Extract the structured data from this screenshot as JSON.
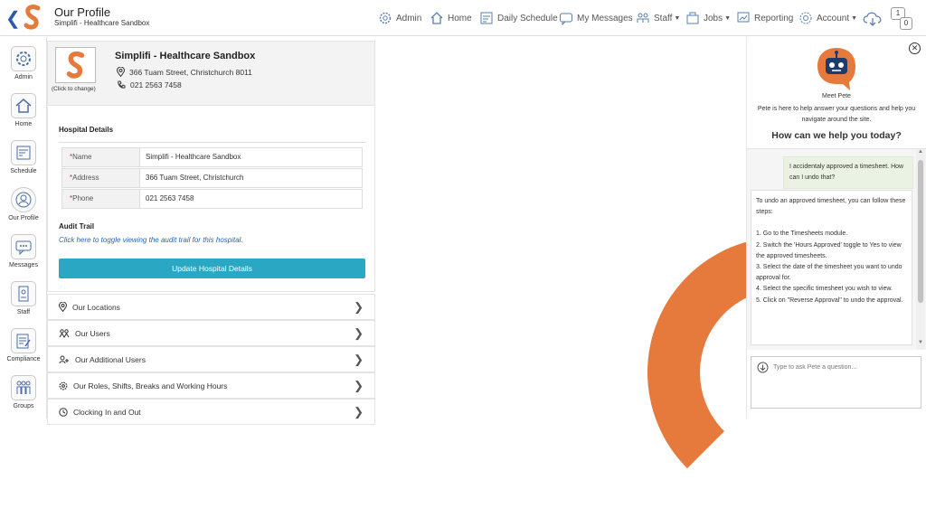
{
  "header": {
    "title": "Our Profile",
    "subtitle": "Simplifi - Healthcare Sandbox",
    "nav": [
      {
        "label": "Admin",
        "icon": "gear-icon"
      },
      {
        "label": "Home",
        "icon": "home-icon"
      },
      {
        "label": "Daily Schedule",
        "icon": "schedule-icon"
      },
      {
        "label": "My Messages",
        "icon": "messages-icon"
      },
      {
        "label": "Staff",
        "icon": "staff-icon"
      },
      {
        "label": "Jobs",
        "icon": "jobs-icon"
      },
      {
        "label": "Reporting",
        "icon": "reporting-icon"
      },
      {
        "label": "Account",
        "icon": "account-icon"
      }
    ],
    "notifications": [
      "1",
      "0"
    ]
  },
  "sidebar": {
    "items": [
      {
        "label": "Admin"
      },
      {
        "label": "Home"
      },
      {
        "label": "Schedule"
      },
      {
        "label": "Our Profile"
      },
      {
        "label": "Messages"
      },
      {
        "label": "Staff"
      },
      {
        "label": "Compliance"
      },
      {
        "label": "Groups"
      }
    ]
  },
  "profile": {
    "logo_caption": "(Click to change)",
    "name": "Simplifi - Healthcare Sandbox",
    "address": "366 Tuam Street, Christchurch 8011",
    "phone": "021 2563 7458"
  },
  "hospital_details": {
    "title": "Hospital Details",
    "fields": [
      {
        "label": "Name",
        "value": "Simplifi - Healthcare Sandbox"
      },
      {
        "label": "Address",
        "value": "366 Tuam Street, Christchurch"
      },
      {
        "label": "Phone",
        "value": "021 2563 7458"
      }
    ],
    "audit_title": "Audit Trail",
    "audit_link": "Click here to toggle viewing the audit trail for this hospital.",
    "update_button": "Update Hospital Details"
  },
  "accordion": [
    {
      "label": "Our Locations",
      "icon": "location-icon"
    },
    {
      "label": "Our Users",
      "icon": "users-icon"
    },
    {
      "label": "Our Additional Users",
      "icon": "add-user-icon"
    },
    {
      "label": "Our Roles, Shifts, Breaks and Working Hours",
      "icon": "gear-icon"
    },
    {
      "label": "Clocking In and Out",
      "icon": "clock-icon"
    }
  ],
  "chat": {
    "meet": "Meet Pete",
    "intro": "Pete is here to help answer your questions and help you navigate around the site.",
    "heading": "How can we help you today?",
    "user_message": "I accidentaly approved a timesheet. How can I undo that?",
    "bot_lines": [
      "To undo an approved timesheet, you can follow these steps:",
      "",
      "1. Go to the Timesheets module.",
      "2. Switch the 'Hours Approved' toggle to Yes to view the approved timesheets.",
      "3. Select the date of the timesheet you want to undo approval for.",
      "4. Select the specific timesheet you wish to view.",
      "5. Click on \"Reverse Approval\" to undo the approval."
    ],
    "input_placeholder": "Type to ask Pete a question..."
  },
  "colors": {
    "brand_orange": "#e57a3c",
    "button_teal": "#2aa7c3",
    "link_blue": "#2a63b0",
    "nav_blue": "#2a5aa8"
  }
}
